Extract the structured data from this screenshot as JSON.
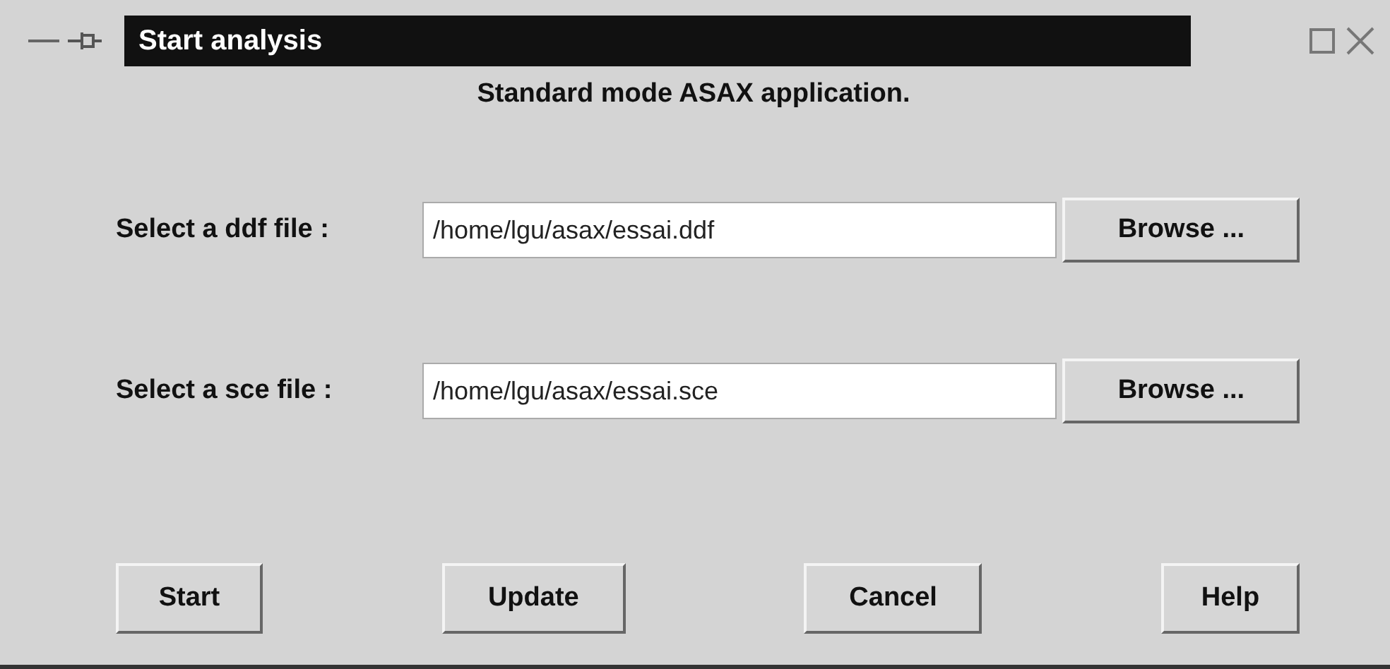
{
  "window": {
    "title": "Start analysis"
  },
  "heading": "Standard mode ASAX application.",
  "file_rows": [
    {
      "label": "Select a ddf file :",
      "value": "/home/lgu/asax/essai.ddf",
      "button": "Browse ..."
    },
    {
      "label": "Select a sce file :",
      "value": "/home/lgu/asax/essai.sce",
      "button": "Browse ..."
    }
  ],
  "buttons": [
    "Start",
    "Update",
    "Cancel",
    "Help"
  ]
}
